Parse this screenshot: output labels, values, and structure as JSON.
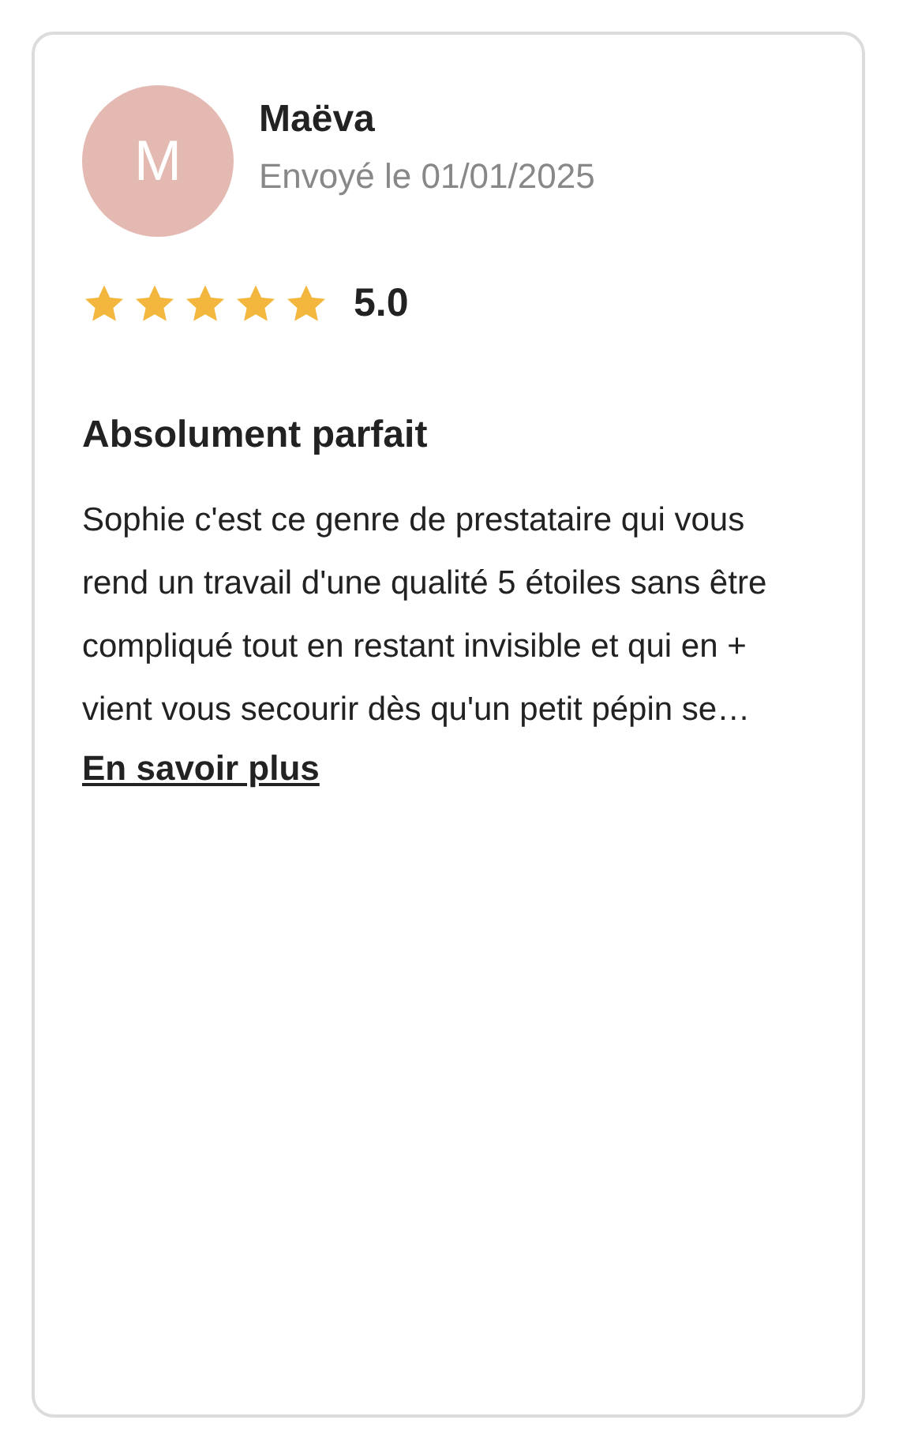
{
  "review": {
    "avatar_initial": "M",
    "author": "Maëva",
    "date": "Envoyé le 01/01/2025",
    "stars": 5,
    "rating": "5.0",
    "title": "Absolument parfait",
    "body": "Sophie c'est ce genre de prestataire qui vous rend un travail d'une qualité 5 étoiles sans être compliqué tout en restant invisible et qui en + vient vous secourir dès qu'un petit pépin se…",
    "link": "En savoir plus"
  }
}
